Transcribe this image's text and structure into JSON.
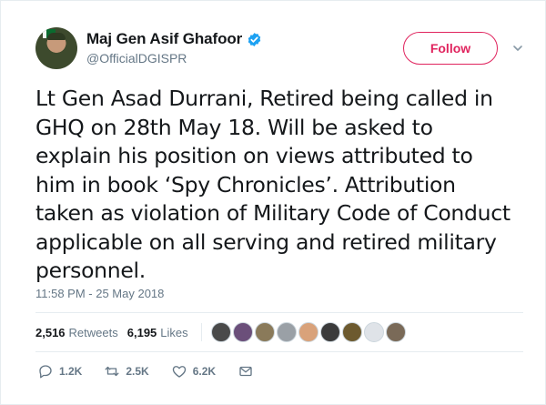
{
  "author": {
    "display_name": "Maj Gen Asif Ghafoor",
    "handle": "@OfficialDGISPR",
    "verified": true
  },
  "follow_button": {
    "label": "Follow"
  },
  "tweet": {
    "lines": [
      "Lt Gen Asad Durrani, Retired being called in",
      "GHQ on 28th May 18. Will be asked to",
      "explain his position on views attributed to",
      "him in book ‘Spy Chronicles’. Attribution",
      "taken as violation of Military Code of Conduct",
      "applicable on all serving and retired military",
      "personnel."
    ],
    "timestamp": "11:58 PM - 25 May 2018"
  },
  "stats": {
    "retweets_count": "2,516",
    "retweets_label": "Retweets",
    "likes_count": "6,195",
    "likes_label": "Likes",
    "liker_avatars": [
      "#4a4a4a",
      "#6b4f7a",
      "#8a7a5a",
      "#9aa0a6",
      "#d9a27a",
      "#3b3b3b",
      "#6d5a2f",
      "#dfe3e8",
      "#7a6a58"
    ]
  },
  "actions": {
    "reply_count": "1.2K",
    "retweet_count": "2.5K",
    "like_count": "6.2K"
  },
  "colors": {
    "follow_accent": "#e0245e",
    "verified_blue": "#1da1f2",
    "muted_text": "#657786"
  }
}
